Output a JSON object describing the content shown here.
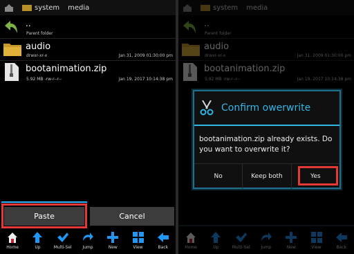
{
  "breadcrumb": {
    "seg1": "system",
    "seg2": "media"
  },
  "parent": {
    "name": "..",
    "label": "Parent folder"
  },
  "files": [
    {
      "name": "audio",
      "attrs": "drwxr-xr-x",
      "date": "Jan 31, 2009 01:30:00 pm",
      "icon": "folder-icon"
    },
    {
      "name": "bootanimation.zip",
      "size": "5.92 MB -rw-r--r--",
      "date": "Jan 19, 2017 10:14:38 pm",
      "icon": "zip-file-icon"
    }
  ],
  "actions": {
    "paste": "Paste",
    "cancel": "Cancel"
  },
  "toolbar": [
    {
      "label": "Home",
      "icon": "home-icon"
    },
    {
      "label": "Up",
      "icon": "up-arrow-icon"
    },
    {
      "label": "Multi-Sel",
      "icon": "checkmark-icon"
    },
    {
      "label": "Jump",
      "icon": "jump-arrow-icon"
    },
    {
      "label": "New",
      "icon": "plus-icon"
    },
    {
      "label": "View",
      "icon": "grid-icon"
    },
    {
      "label": "Back",
      "icon": "back-arrow-icon"
    }
  ],
  "dialog": {
    "title": "Confirm owerwrite",
    "message": "bootanimation.zip already exists. Do you want to overwrite it?",
    "buttons": {
      "no": "No",
      "keep_both": "Keep both",
      "yes": "Yes"
    }
  },
  "colors": {
    "accent": "#33b5e5",
    "highlight": "#e53935",
    "toolbar_blue": "#2196f3"
  }
}
